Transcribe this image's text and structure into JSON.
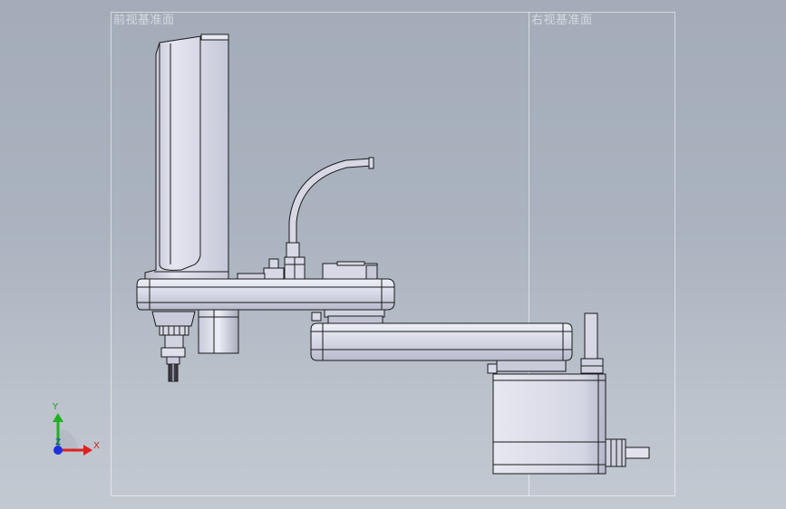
{
  "views": {
    "left_label": "前视基准面",
    "right_label": "右视基准面"
  },
  "triad": {
    "x_label": "X",
    "y_label": "Y",
    "z_label": "Z"
  },
  "colors": {
    "background_top": "#a3acb8",
    "background_bottom": "#c3c9d1",
    "part_body": "#d8d9e6",
    "part_edge": "#1a1a1a",
    "axis_x": "#e02020",
    "axis_y": "#20b020",
    "axis_z": "#2030e0"
  }
}
